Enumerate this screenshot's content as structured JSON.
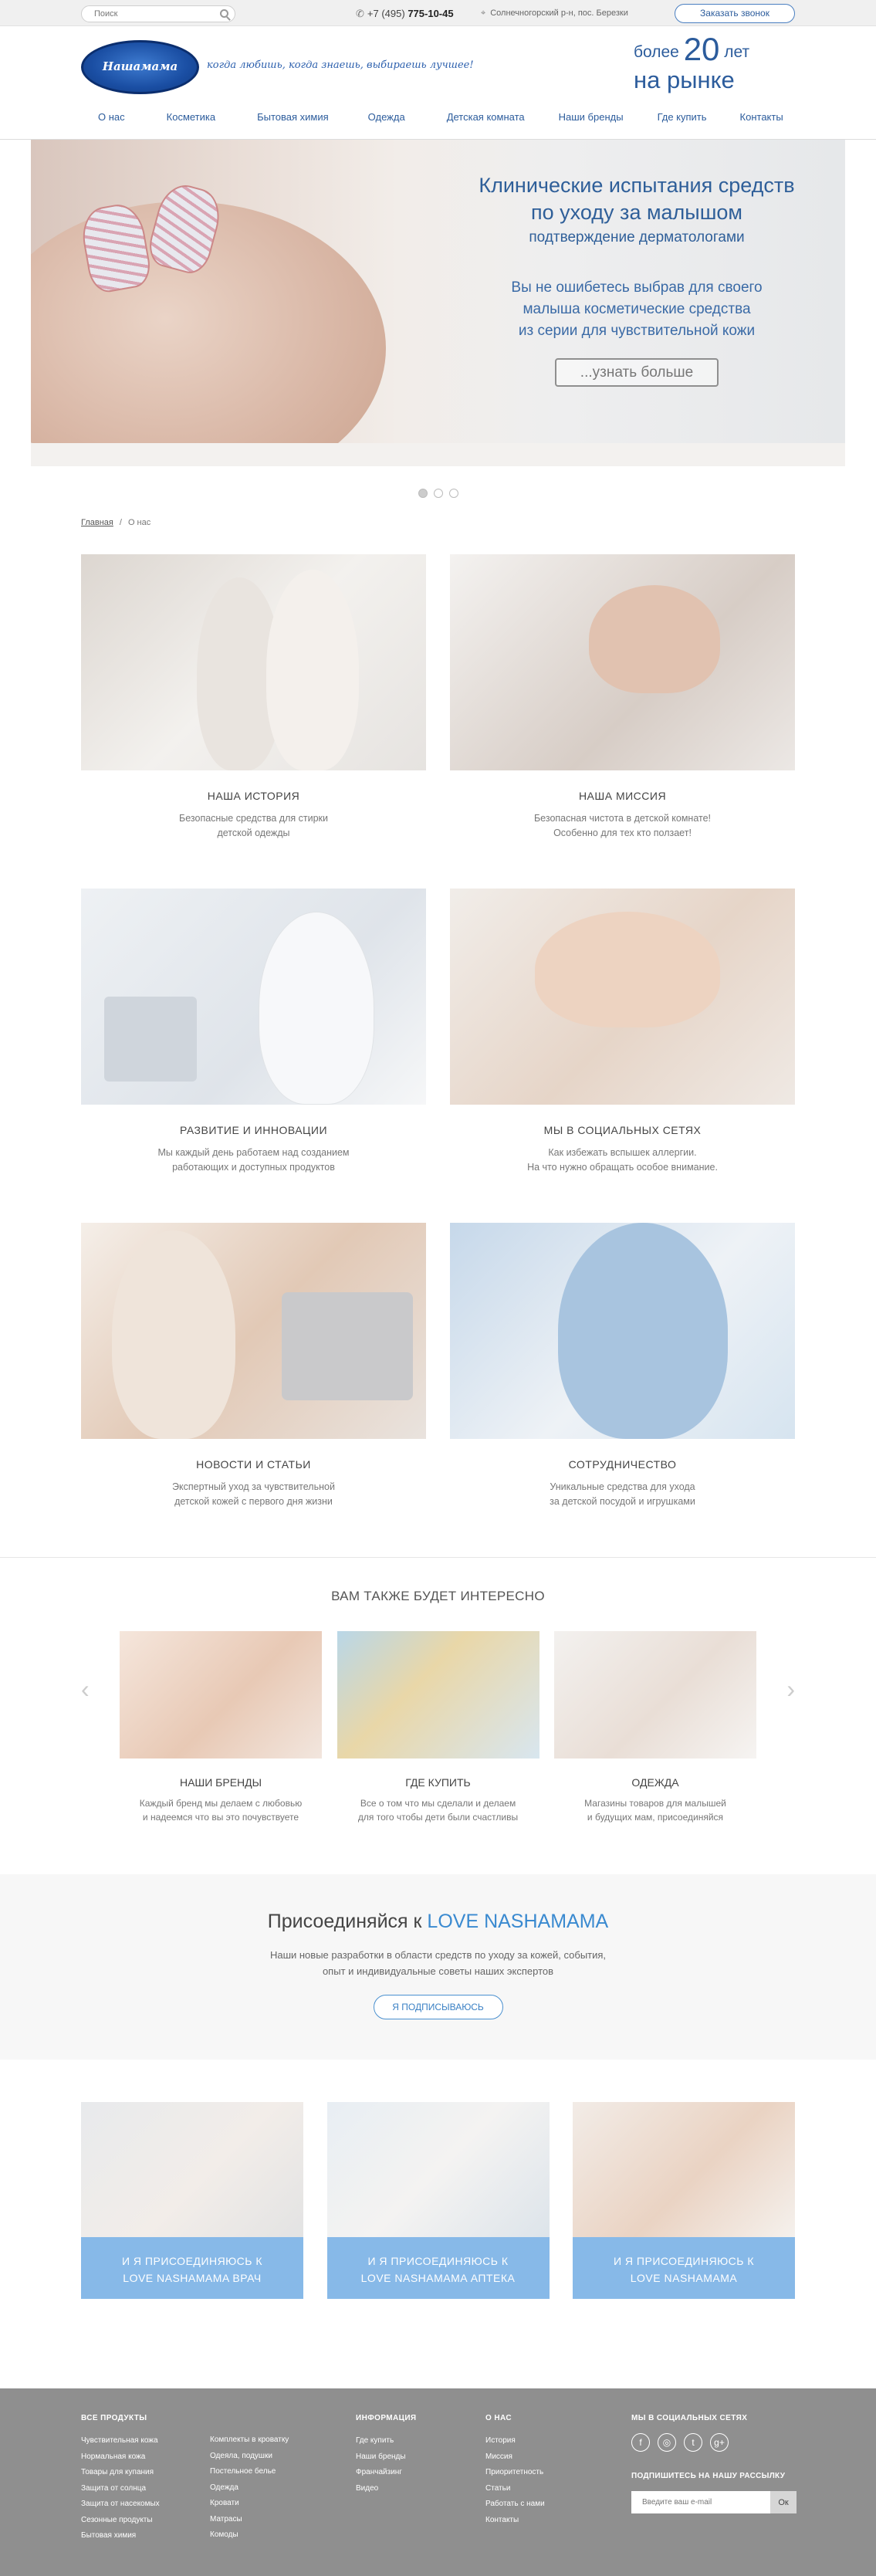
{
  "topbar": {
    "search_placeholder": "Поиск",
    "phone_prefix": "+7 (495)",
    "phone_number": "775-10-45",
    "address": "Солнечногорский р-н, пос. Березки",
    "callback_label": "Заказать звонок"
  },
  "header": {
    "logo_text": "Нашамама",
    "slogan": "когда любишь, когда знаешь, выбираешь лучшее!",
    "years_prefix": "более",
    "years_number": "20",
    "years_unit": "лет",
    "years_line2": "на рынке"
  },
  "nav": [
    "О нас",
    "Косметика",
    "Бытовая химия",
    "Одежда",
    "Детская комната",
    "Наши бренды",
    "Где купить",
    "Контакты"
  ],
  "hero": {
    "title_line1": "Клинические испытания средств",
    "title_line2": "по уходу за малышом",
    "subtitle": "подтверждение  дерматологами",
    "text_line1": "Вы не ошибетесь выбрав для своего",
    "text_line2": "малыша косметические средства",
    "text_line3": "из серии для чувствительной кожи",
    "button": "...узнать больше"
  },
  "breadcrumbs": {
    "home": "Главная",
    "separator": "/",
    "current": "О нас"
  },
  "tiles": [
    {
      "title": "НАША ИСТОРИЯ",
      "desc1": "Безопасные средства для стирки",
      "desc2": "детской одежды"
    },
    {
      "title": "НАША МИССИЯ",
      "desc1": "Безопасная чистота в детской комнате!",
      "desc2": "Особенно для тех кто ползает!"
    },
    {
      "title": "РАЗВИТИЕ И ИННОВАЦИИ",
      "desc1": "Мы каждый день работаем над созданием",
      "desc2": "работающих и доступных продуктов"
    },
    {
      "title": "МЫ В СОЦИАЛЬНЫХ СЕТЯХ",
      "desc1": "Как избежать вспышек аллергии.",
      "desc2": "На что нужно обращать особое внимание."
    },
    {
      "title": "НОВОСТИ И СТАТЬИ",
      "desc1": "Экспертный уход за чувствительной",
      "desc2": "детской кожей с первого дня жизни"
    },
    {
      "title": "СОТРУДНИЧЕСТВО",
      "desc1": "Уникальные средства для ухода",
      "desc2": "за детской посудой и игрушками"
    }
  ],
  "also": {
    "heading": "ВАМ ТАКЖЕ БУДЕТ ИНТЕРЕСНО",
    "items": [
      {
        "title": "НАШИ БРЕНДЫ",
        "desc1": "Каждый бренд мы делаем с любовью",
        "desc2": "и надеемся что вы это почувствуете"
      },
      {
        "title": "ГДЕ КУПИТЬ",
        "desc1": "Все о том что мы сделали и делаем",
        "desc2": "для того чтобы дети были счастливы"
      },
      {
        "title": "ОДЕЖДА",
        "desc1": "Магазины товаров для малышей",
        "desc2": "и будущих мам, присоединяйся"
      }
    ]
  },
  "join": {
    "title_prefix": "Присоединяйся к",
    "title_brand": "LOVE NASHAMAMA",
    "text_line1": "Наши новые разработки в области средств по уходу за кожей, события,",
    "text_line2": "опыт и индивидуальные советы наших экспертов",
    "button": "Я ПОДПИСЫВАЮСЬ"
  },
  "cards": [
    {
      "line1": "И Я ПРИСОЕДИНЯЮСЬ К",
      "line2": "LOVE NASHAMAMA ВРАЧ"
    },
    {
      "line1": "И Я ПРИСОЕДИНЯЮСЬ К",
      "line2": "LOVE NASHAMAMA АПТЕКА"
    },
    {
      "line1": "И Я ПРИСОЕДИНЯЮСЬ К",
      "line2": "LOVE NASHAMAMA"
    }
  ],
  "footer": {
    "products_heading": "ВСЕ ПРОДУКТЫ",
    "products_col1": [
      "Чувствительная кожа",
      "Нормальная кожа",
      "Товары для купания",
      "Защита от солнца",
      "Защита от насекомых",
      "Сезонные продукты",
      "Бытовая химия"
    ],
    "products_col2": [
      "Комплекты в кроватку",
      "Одеяла, подушки",
      "Постельное белье",
      "Одежда",
      "Кровати",
      "Матрасы",
      "Комоды"
    ],
    "info_heading": "ИНФОРМАЦИЯ",
    "info_links": [
      "Где купить",
      "Наши бренды",
      "Франчайзинг",
      "Видео"
    ],
    "about_heading": "О НАС",
    "about_links": [
      "История",
      "Миссия",
      "Приоритетность",
      "Статьи",
      "Работать с нами",
      "Контакты"
    ],
    "social_heading": "МЫ В СОЦИАЛЬНЫХ СЕТЯХ",
    "social_icons": [
      "f",
      "◎",
      "t",
      "g+"
    ],
    "subscribe_heading": "ПОДПИШИТЕСЬ НА НАШУ РАССЫЛКУ",
    "subscribe_placeholder": "Введите ваш e-mail",
    "subscribe_button": "Ок"
  },
  "colors": {
    "brand_blue": "#2c5c9c",
    "accent_blue": "#3a8ad0",
    "card_band": "#87b9e8",
    "footer_bg": "#8f8f8f"
  }
}
